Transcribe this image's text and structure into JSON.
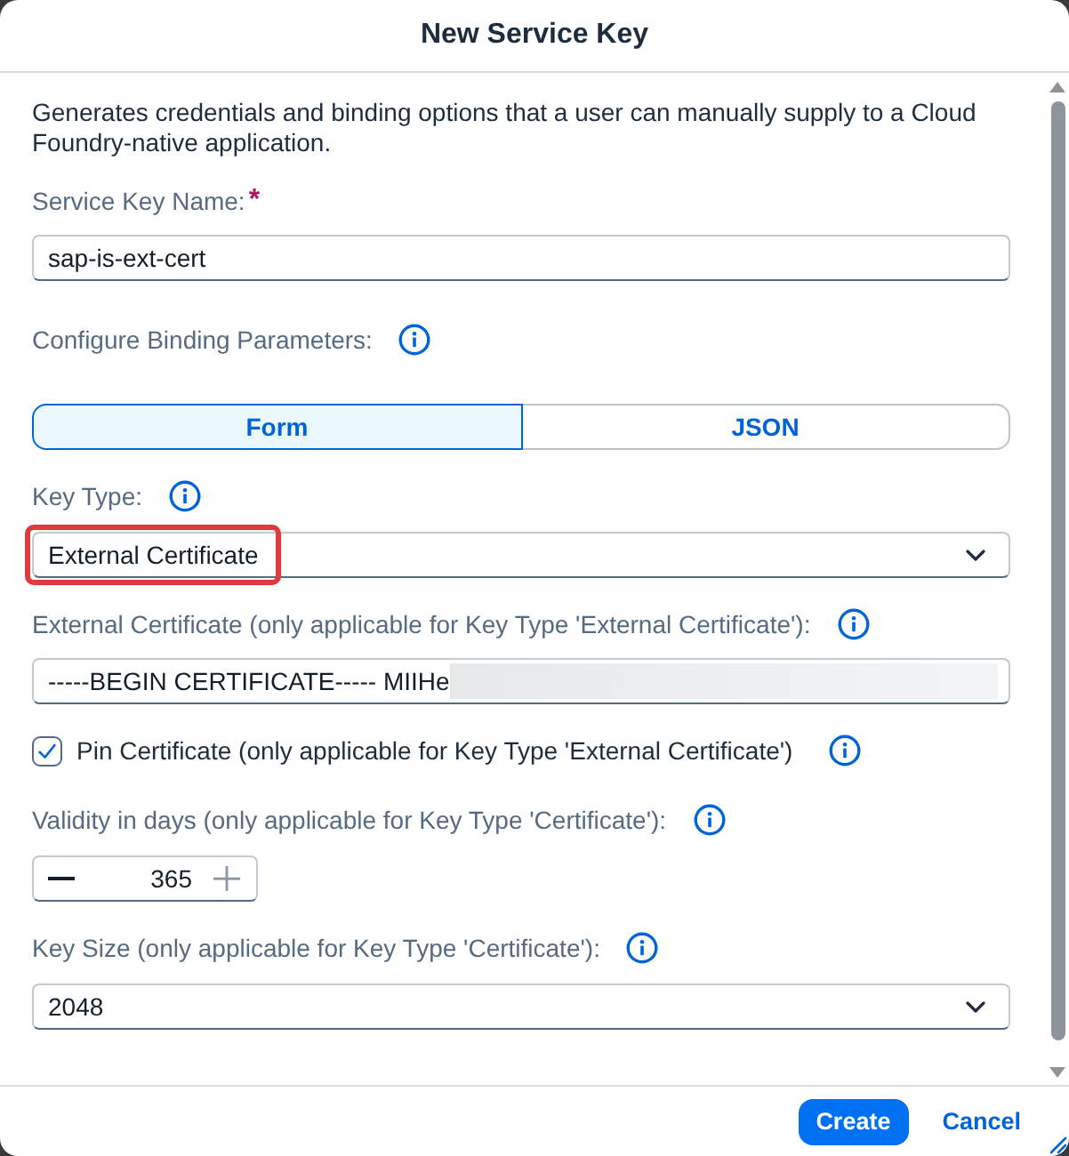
{
  "dialog": {
    "title": "New Service Key",
    "description": "Generates credentials and binding options that a user can manually supply to a Cloud Foundry-native application.",
    "fields": [
      {
        "kind": "text",
        "label": "Service Key Name:",
        "required_mark": "*",
        "info": false,
        "value": "sap-is-ext-cert"
      },
      {
        "kind": "segmented",
        "label": "Configure Binding Parameters:",
        "info": true,
        "options": [
          {
            "label": "Form",
            "selected": true
          },
          {
            "label": "JSON",
            "selected": false
          }
        ]
      },
      {
        "kind": "select",
        "label": "Key Type:",
        "info": true,
        "value": "External Certificate",
        "highlighted": true
      },
      {
        "kind": "text",
        "label": "External Certificate (only applicable for Key Type 'External Certificate'):",
        "info": true,
        "value": "-----BEGIN CERTIFICATE----- MIIHe",
        "redacted": true
      },
      {
        "kind": "checkbox",
        "label": "Pin Certificate (only applicable for Key Type 'External Certificate')",
        "info": true,
        "checked": true
      },
      {
        "kind": "stepper",
        "label": "Validity in days (only applicable for Key Type 'Certificate'):",
        "info": true,
        "value": "365",
        "increase_disabled": true
      },
      {
        "kind": "select",
        "label": "Key Size (only applicable for Key Type 'Certificate'):",
        "info": true,
        "value": "2048",
        "highlighted": false
      }
    ],
    "buttons": [
      {
        "label": "Create",
        "kind": "emphasized"
      },
      {
        "label": "Cancel",
        "kind": "transparent"
      }
    ]
  }
}
